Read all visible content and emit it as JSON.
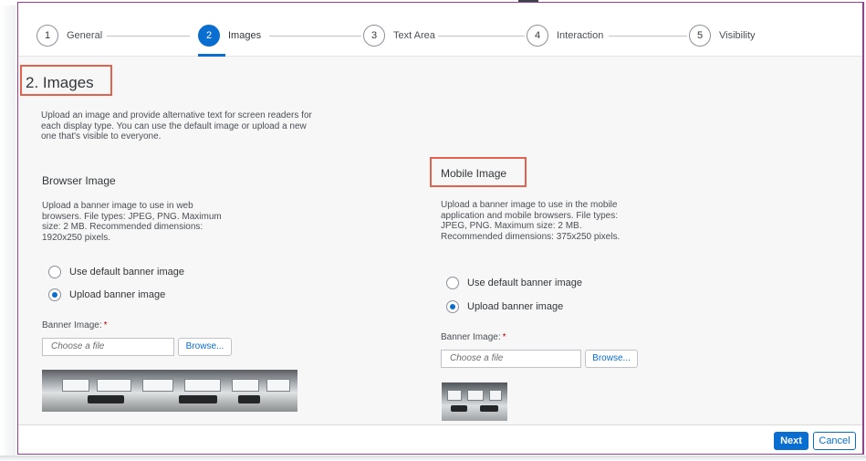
{
  "wizard": {
    "steps": [
      {
        "number": "1",
        "label": "General"
      },
      {
        "number": "2",
        "label": "Images"
      },
      {
        "number": "3",
        "label": "Text Area"
      },
      {
        "number": "4",
        "label": "Interaction"
      },
      {
        "number": "5",
        "label": "Visibility"
      }
    ],
    "active_step": 2
  },
  "section": {
    "title": "2. Images",
    "description": "Upload an image and provide alternative text for screen readers for each display type. You can use the default image or upload a new one that's visible to everyone."
  },
  "browser": {
    "title": "Browser Image",
    "description": "Upload a banner image to use in web browsers. File types: JPEG, PNG. Maximum size: 2 MB. Recommended dimensions: 1920x250 pixels.",
    "option_default": "Use default banner image",
    "option_upload": "Upload banner image",
    "selected_option": "upload",
    "field_label": "Banner Image:",
    "required_mark": "*",
    "file_placeholder": "Choose a file",
    "browse_label": "Browse..."
  },
  "mobile": {
    "title": "Mobile Image",
    "description": "Upload a banner image to use in the mobile application and mobile browsers. File types: JPEG, PNG. Maximum size: 2 MB. Recommended dimensions: 375x250 pixels.",
    "option_default": "Use default banner image",
    "option_upload": "Upload banner image",
    "selected_option": "upload",
    "field_label": "Banner Image:",
    "required_mark": "*",
    "file_placeholder": "Choose a file",
    "browse_label": "Browse..."
  },
  "footer": {
    "next_label": "Next",
    "cancel_label": "Cancel"
  },
  "colors": {
    "accent": "#0a6ed1",
    "highlight_box": "#e0624f",
    "frame": "#a4379b"
  }
}
